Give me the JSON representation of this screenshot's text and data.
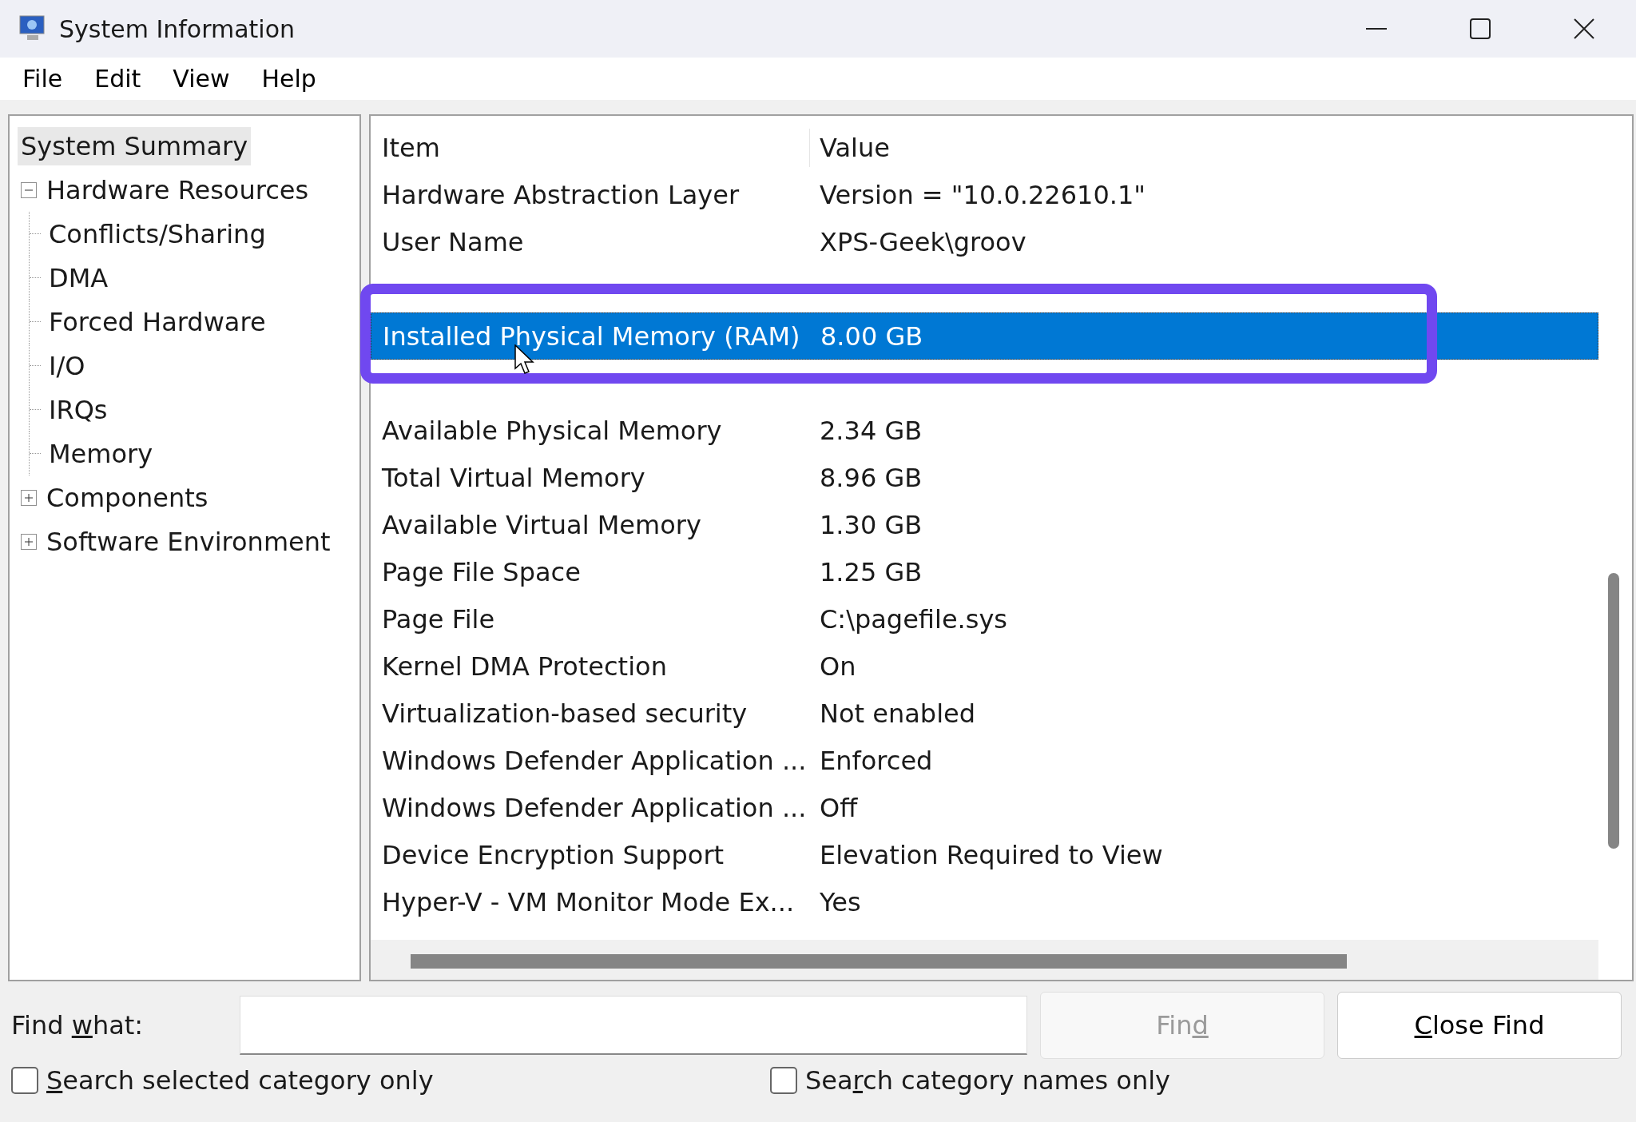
{
  "window": {
    "title": "System Information"
  },
  "menu": [
    {
      "label": "File"
    },
    {
      "label": "Edit"
    },
    {
      "label": "View"
    },
    {
      "label": "Help"
    }
  ],
  "tree": [
    {
      "label": "System Summary",
      "selected": true
    },
    {
      "label": "Hardware Resources",
      "selected": false,
      "expanded": true,
      "children": [
        {
          "label": "Conflicts/Sharing",
          "selected": false
        },
        {
          "label": "DMA",
          "selected": false
        },
        {
          "label": "Forced Hardware",
          "selected": false
        },
        {
          "label": "I/O",
          "selected": false
        },
        {
          "label": "IRQs",
          "selected": false
        },
        {
          "label": "Memory",
          "selected": false
        }
      ]
    },
    {
      "label": "Components",
      "selected": false,
      "expanded": false
    },
    {
      "label": "Software Environment",
      "selected": false,
      "expanded": false
    }
  ],
  "table": {
    "columns": [
      "Item",
      "Value"
    ],
    "rows": [
      {
        "item": "Hardware Abstraction Layer",
        "value": "Version = \"10.0.22610.1\"",
        "selected": false,
        "highlighted": false
      },
      {
        "item": "User Name",
        "value": "XPS-Geek\\groov",
        "selected": false,
        "highlighted": false
      },
      {
        "selected": false,
        "highlighted": false
      },
      {
        "item": "Installed Physical Memory (RAM)",
        "value": "8.00 GB",
        "selected": true,
        "highlighted": true
      },
      {
        "selected": false,
        "highlighted": false
      },
      {
        "item": "Available Physical Memory",
        "value": "2.34 GB",
        "selected": false,
        "highlighted": false
      },
      {
        "item": "Total Virtual Memory",
        "value": "8.96 GB",
        "selected": false,
        "highlighted": false
      },
      {
        "item": "Available Virtual Memory",
        "value": "1.30 GB",
        "selected": false,
        "highlighted": false
      },
      {
        "item": "Page File Space",
        "value": "1.25 GB",
        "selected": false,
        "highlighted": false
      },
      {
        "item": "Page File",
        "value": "C:\\pagefile.sys",
        "selected": false,
        "highlighted": false
      },
      {
        "item": "Kernel DMA Protection",
        "value": "On",
        "selected": false,
        "highlighted": false
      },
      {
        "item": "Virtualization-based security",
        "value": "Not enabled",
        "selected": false,
        "highlighted": false
      },
      {
        "item": "Windows Defender Application ...",
        "value": "Enforced",
        "selected": false,
        "highlighted": false
      },
      {
        "item": "Windows Defender Application ...",
        "value": "Off",
        "selected": false,
        "highlighted": false
      },
      {
        "item": "Device Encryption Support",
        "value": "Elevation Required to View",
        "selected": false,
        "highlighted": false
      },
      {
        "item": "Hyper-V - VM Monitor Mode Ex...",
        "value": "Yes",
        "selected": false,
        "highlighted": false
      }
    ]
  },
  "find": {
    "label": {
      "before": "Find ",
      "key": "w",
      "after": "hat:"
    },
    "buttons": [
      {
        "before": "Fin",
        "key": "d",
        "disabled": true
      },
      {
        "key": "C",
        "after": "lose Find",
        "disabled": false
      }
    ],
    "checkboxes": [
      {
        "key": "S",
        "after": "earch selected category only",
        "checked": false
      },
      {
        "before": "Sea",
        "key": "r",
        "after": "ch category names only",
        "checked": false
      }
    ]
  }
}
